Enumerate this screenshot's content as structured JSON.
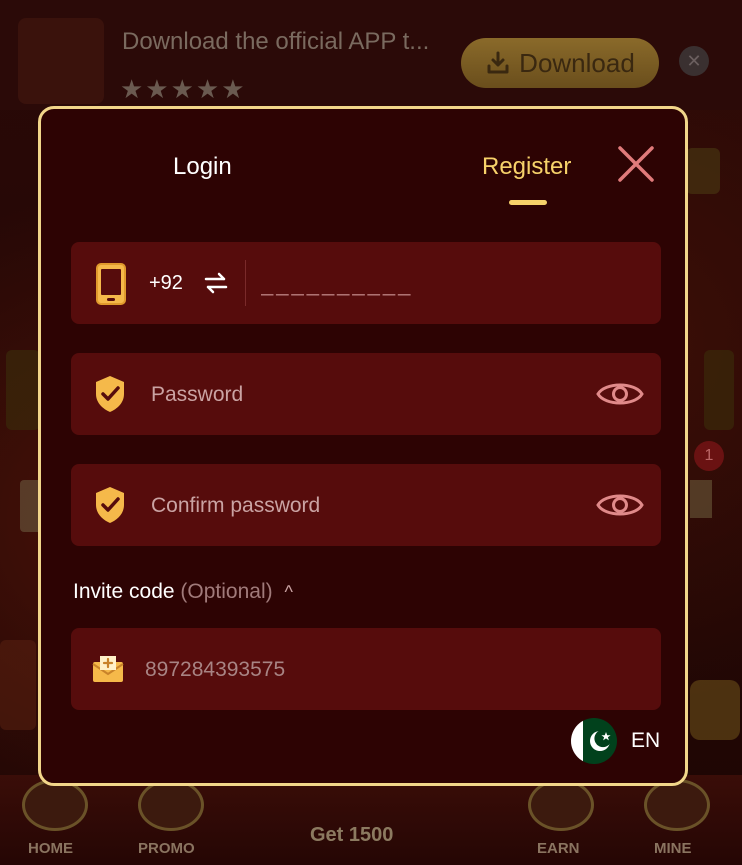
{
  "banner": {
    "text": "Download the official APP t...",
    "stars": "★★★★★",
    "download_label": "Download",
    "close_icon": "close-icon"
  },
  "modal": {
    "tabs": [
      {
        "label": "Login",
        "active": false
      },
      {
        "label": "Register",
        "active": true
      }
    ],
    "close_icon": "close-icon",
    "phone": {
      "icon": "phone-icon",
      "country_code": "+92",
      "swap_icon": "swap-arrows-icon",
      "placeholder": "__________"
    },
    "password": {
      "icon": "shield-check-icon",
      "placeholder": "Password",
      "eye_icon": "eye-icon"
    },
    "confirm_password": {
      "icon": "shield-check-icon",
      "placeholder": "Confirm password",
      "eye_icon": "eye-icon"
    },
    "invite": {
      "label": "Invite code",
      "optional_label": "(Optional)",
      "caret": "^",
      "icon": "mail-icon",
      "value": "897284393575"
    },
    "language": {
      "flag": "pakistan-flag-icon",
      "label": "EN"
    }
  },
  "bottom_nav": {
    "items": [
      {
        "label": "HOME"
      },
      {
        "label": "PROMO"
      },
      {
        "label": "Get 1500"
      },
      {
        "label": "EARN"
      },
      {
        "label": "MINE"
      }
    ]
  },
  "side_badge": "1",
  "colors": {
    "accent": "#f7d26a",
    "modal_bg": "#2d0303",
    "field_bg": "#560c0c",
    "border": "#f2d68a"
  }
}
